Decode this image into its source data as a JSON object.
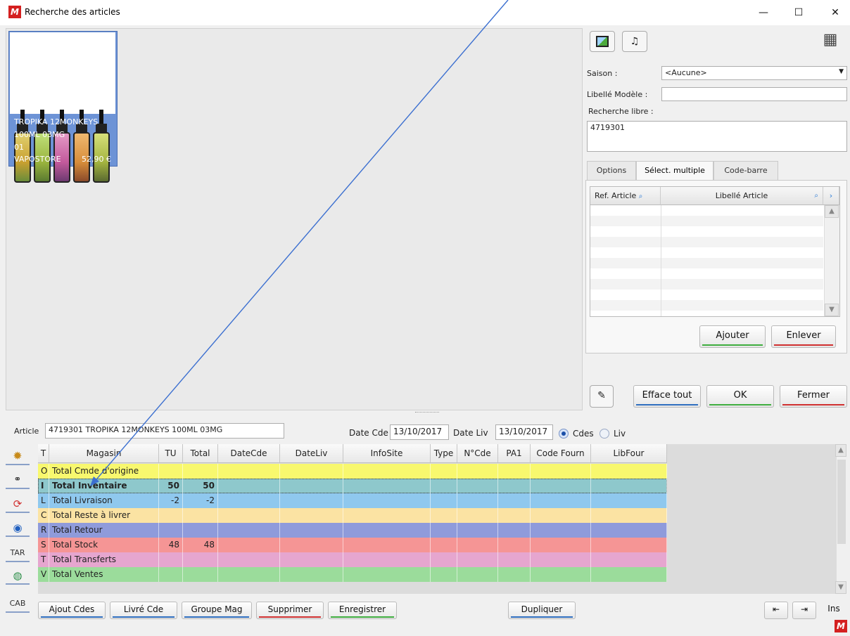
{
  "window": {
    "title": "Recherche des articles",
    "minimize": "—",
    "maximize": "☐",
    "close": "✕",
    "logo": "M"
  },
  "product": {
    "name": "TROPIKA 12MONKEYS",
    "line2": "100ML 03MG",
    "line3": "01",
    "store": "VAPOSTORE",
    "price": "52,90 €"
  },
  "filters": {
    "saison_label": "Saison :",
    "saison_value": "<Aucune>",
    "libelle_label": "Libellé Modèle :",
    "libelle_value": "",
    "recherche_label": "Recherche libre :",
    "recherche_value": "4719301"
  },
  "tabs": [
    "Options",
    "Sélect. multiple",
    "Code-barre"
  ],
  "multi_select": {
    "col_ref": "Ref. Article",
    "col_lib": "Libellé Article",
    "add": "Ajouter",
    "remove": "Enlever"
  },
  "actions": {
    "efface": "Efface tout",
    "ok": "OK",
    "fermer": "Fermer"
  },
  "article": {
    "label": "Article",
    "value": "4719301 TROPIKA 12MONKEYS 100ML 03MG",
    "date_cde_label": "Date Cde",
    "date_cde": "13/10/2017",
    "date_liv_label": "Date Liv",
    "date_liv": "13/10/2017",
    "radio_cdes": "Cdes",
    "radio_liv": "Liv"
  },
  "grid": {
    "headers": [
      "T",
      "Magasin",
      "TU",
      "Total",
      "DateCde",
      "DateLiv",
      "InfoSite",
      "Type",
      "N°Cde",
      "PA1",
      "Code Fourn",
      "LibFour"
    ],
    "rows": [
      {
        "t": "O",
        "magasin": "Total Cmde d'origine",
        "tu": "",
        "total": "",
        "color": "#f8f86e"
      },
      {
        "t": "I",
        "magasin": "Total Inventaire",
        "tu": "50",
        "total": "50",
        "color": "#8ec8cc"
      },
      {
        "t": "L",
        "magasin": "Total Livraison",
        "tu": "-2",
        "total": "-2",
        "color": "#8fc8ee"
      },
      {
        "t": "C",
        "magasin": "Total Reste à livrer",
        "tu": "",
        "total": "",
        "color": "#fbe3a3"
      },
      {
        "t": "R",
        "magasin": "Total Retour",
        "tu": "",
        "total": "",
        "color": "#8f9bdb"
      },
      {
        "t": "S",
        "magasin": "Total Stock",
        "tu": "48",
        "total": "48",
        "color": "#f59595"
      },
      {
        "t": "T",
        "magasin": "Total Transferts",
        "tu": "",
        "total": "",
        "color": "#e6a6cf"
      },
      {
        "t": "V",
        "magasin": "Total Ventes",
        "tu": "",
        "total": "",
        "color": "#9bdc9b"
      }
    ]
  },
  "left_toolbar": {
    "tar": "TAR",
    "cab": "CAB"
  },
  "bottom_buttons": {
    "ajout": "Ajout Cdes",
    "livre": "Livré Cde",
    "groupe": "Groupe Mag",
    "supprimer": "Supprimer",
    "enregistrer": "Enregistrer",
    "dupliquer": "Dupliquer",
    "ins": "Ins"
  }
}
